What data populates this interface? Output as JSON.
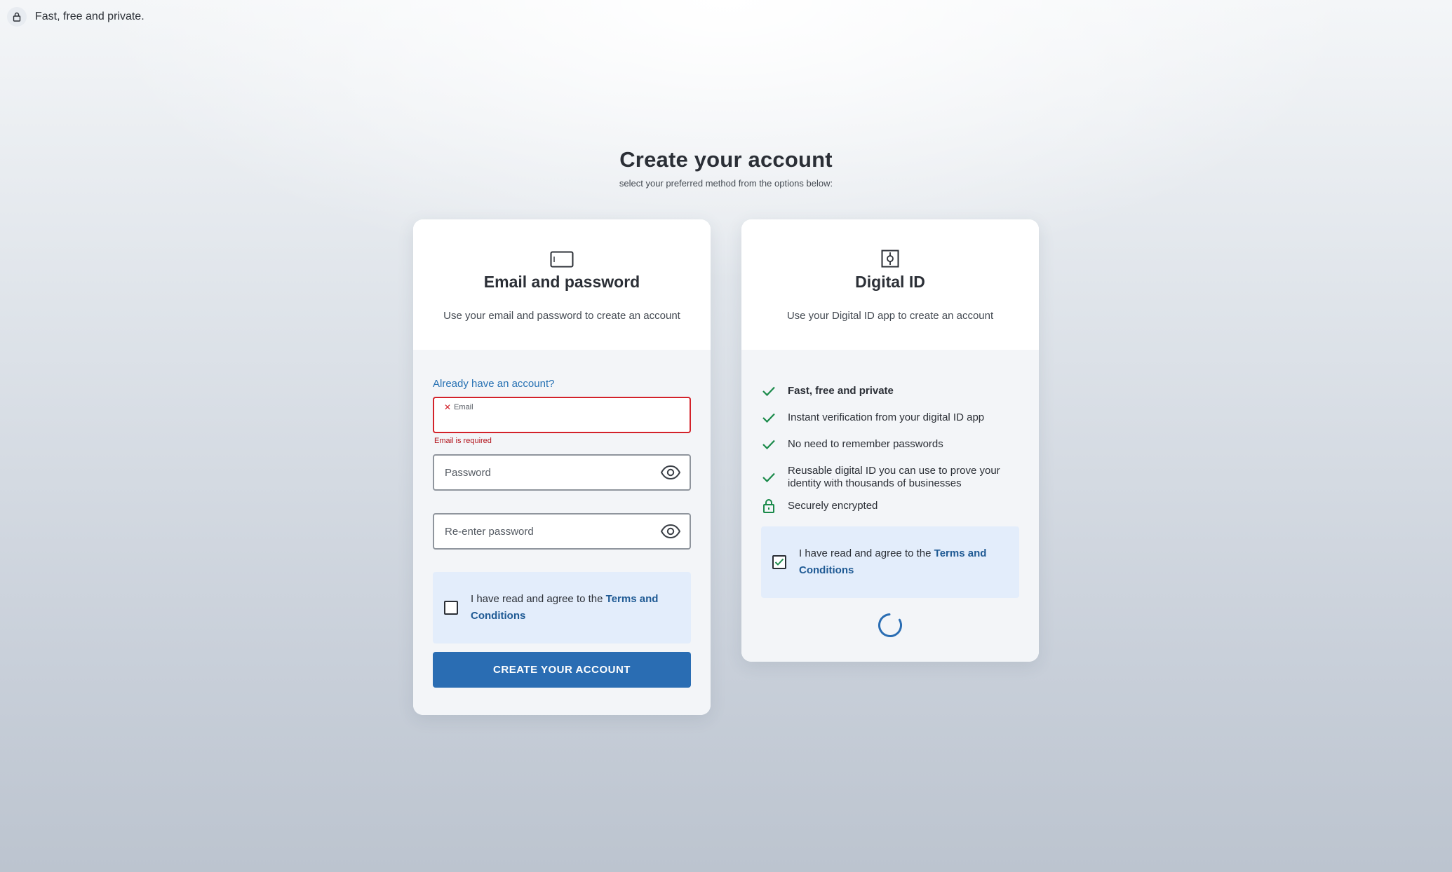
{
  "topbar": {
    "text": "Fast, free and private.",
    "icon": "lock-icon"
  },
  "page": {
    "title": "Create your account",
    "subtitle": "select your preferred method from the options below:"
  },
  "email_card": {
    "icon": "card-icon",
    "title": "Email and password",
    "description": "Use your email and password to create an account",
    "already_link": "Already have an account?",
    "email_label": "Email",
    "email_value": "",
    "email_error": "Email is required",
    "password_placeholder": "Password",
    "reenter_placeholder": "Re-enter password",
    "terms_prefix": "I have read and agree to the ",
    "terms_link": "Terms and Conditions",
    "terms_checked": false,
    "submit_label": "CREATE YOUR ACCOUNT"
  },
  "digital_card": {
    "icon": "safe-icon",
    "title": "Digital ID",
    "description": "Use your Digital ID app to create an account",
    "features": [
      {
        "text": "Fast, free and private",
        "icon": "check-icon"
      },
      {
        "text": "Instant verification from your digital ID app",
        "icon": "check-icon"
      },
      {
        "text": "No need to remember passwords",
        "icon": "check-icon"
      },
      {
        "text": "Reusable digital ID you can use to prove your identity with thousands of businesses",
        "icon": "check-icon"
      },
      {
        "text": "Securely encrypted",
        "icon": "lock-icon"
      }
    ],
    "terms_prefix": "I have read and agree to the ",
    "terms_link": "Terms and Conditions",
    "terms_checked": true,
    "loading_icon": "spinner-icon"
  },
  "colors": {
    "primary": "#2a6db3",
    "link": "#2671b3",
    "error": "#d3222a",
    "success": "#1a8a4a",
    "terms_bg": "#e3edfb"
  }
}
